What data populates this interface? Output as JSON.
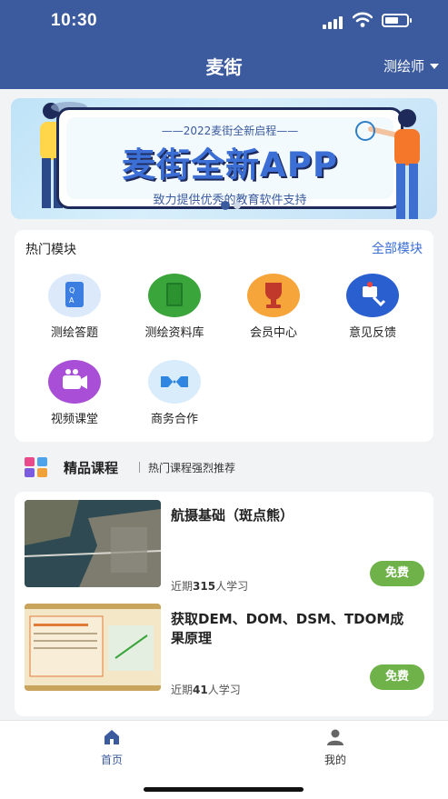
{
  "status_bar": {
    "time": "10:30"
  },
  "header": {
    "title": "麦街",
    "role": "测绘师"
  },
  "banner": {
    "subtitle": "——2022麦街全新启程——",
    "headline": "麦街全新APP",
    "tagline": "致力提供优秀的教育软件支持",
    "slide_count": 2,
    "active_slide": 1
  },
  "hot_modules": {
    "title": "热门模块",
    "more_label": "全部模块",
    "items": [
      {
        "label": "测绘答题",
        "icon": "qa-document-icon",
        "color": "#3b7de0"
      },
      {
        "label": "测绘资料库",
        "icon": "book-icon",
        "color": "#3aa53a"
      },
      {
        "label": "会员中心",
        "icon": "trophy-icon",
        "color": "#f08a1c"
      },
      {
        "label": "意见反馈",
        "icon": "phone-feedback-icon",
        "color": "#2a5fd0"
      },
      {
        "label": "视频课堂",
        "icon": "video-camera-icon",
        "color": "#a040d0"
      },
      {
        "label": "商务合作",
        "icon": "handshake-icon",
        "color": "#2f86e0"
      }
    ]
  },
  "premium": {
    "title": "精品课程",
    "subtitle": "热门课程强烈推荐"
  },
  "courses": [
    {
      "title": "航摄基础（斑点熊）",
      "meta_prefix": "近期",
      "count": "315",
      "meta_suffix": "人学习",
      "price_label": "免费"
    },
    {
      "title": "获取DEM、DOM、DSM、TDOM成果原理",
      "meta_prefix": "近期",
      "count": "41",
      "meta_suffix": "人学习",
      "price_label": "免费"
    }
  ],
  "tabbar": {
    "items": [
      {
        "label": "首页",
        "icon": "home-icon",
        "active": true
      },
      {
        "label": "我的",
        "icon": "user-icon",
        "active": false
      }
    ]
  },
  "colors": {
    "primary": "#3b5b9e",
    "accent": "#3b6fd6",
    "free": "#6fb24a"
  }
}
